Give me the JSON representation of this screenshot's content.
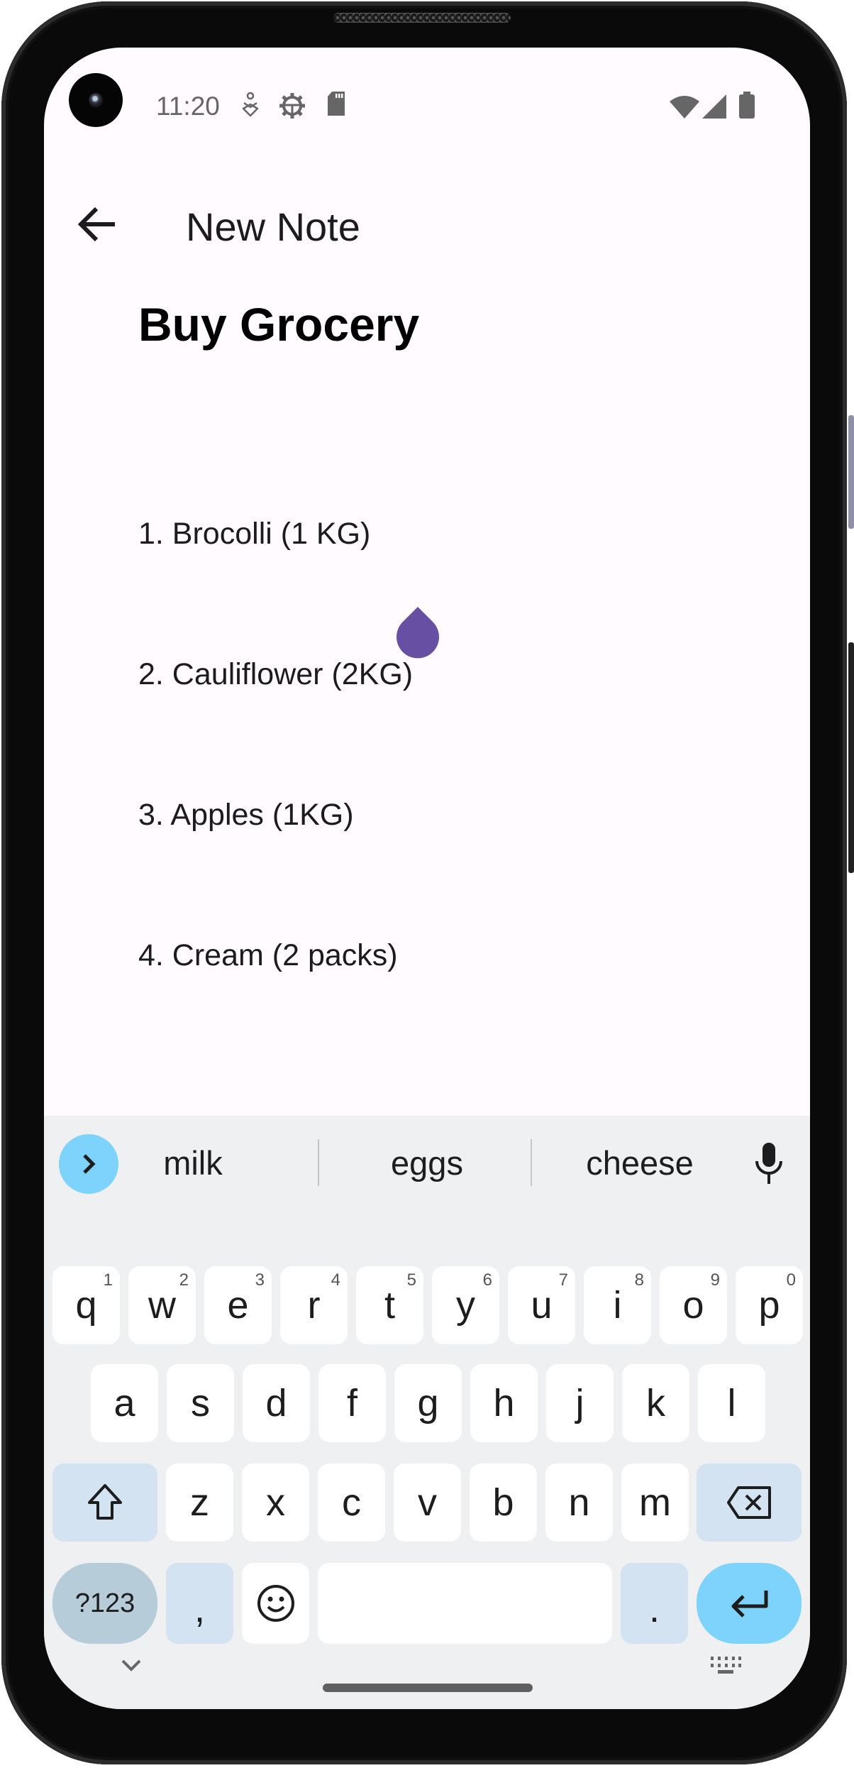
{
  "status_bar": {
    "time": "11:20",
    "left_icons": [
      "accessibility-icon",
      "debug-gear-icon",
      "sd-card-icon"
    ],
    "right_icons": [
      "wifi-icon",
      "cell-signal-icon",
      "battery-icon"
    ]
  },
  "top_bar": {
    "back_icon": "arrow-back-icon",
    "title": "New Note"
  },
  "note": {
    "title": "Buy Grocery",
    "items": [
      "1. Brocolli (1 KG)",
      "2. Cauliflower (2KG)",
      "3. Apples (1KG)",
      "4. Cream (2 packs)"
    ],
    "cursor_handle_color": "#6750a4"
  },
  "keyboard": {
    "suggestions": [
      "milk",
      "eggs",
      "cheese"
    ],
    "row1": [
      {
        "key": "q",
        "hint": "1"
      },
      {
        "key": "w",
        "hint": "2"
      },
      {
        "key": "e",
        "hint": "3"
      },
      {
        "key": "r",
        "hint": "4"
      },
      {
        "key": "t",
        "hint": "5"
      },
      {
        "key": "y",
        "hint": "6"
      },
      {
        "key": "u",
        "hint": "7"
      },
      {
        "key": "i",
        "hint": "8"
      },
      {
        "key": "o",
        "hint": "9"
      },
      {
        "key": "p",
        "hint": "0"
      }
    ],
    "row2": [
      "a",
      "s",
      "d",
      "f",
      "g",
      "h",
      "j",
      "k",
      "l"
    ],
    "row3": [
      "z",
      "x",
      "c",
      "v",
      "b",
      "n",
      "m"
    ],
    "symbols_label": "?123",
    "comma": ",",
    "period": ".",
    "accent_color": "#7dd3fc",
    "modifier_color": "#d3e3f2"
  },
  "nav": {
    "hide_keyboard_icon": "chevron-down-icon",
    "switch_keyboard_icon": "keyboard-icon"
  }
}
